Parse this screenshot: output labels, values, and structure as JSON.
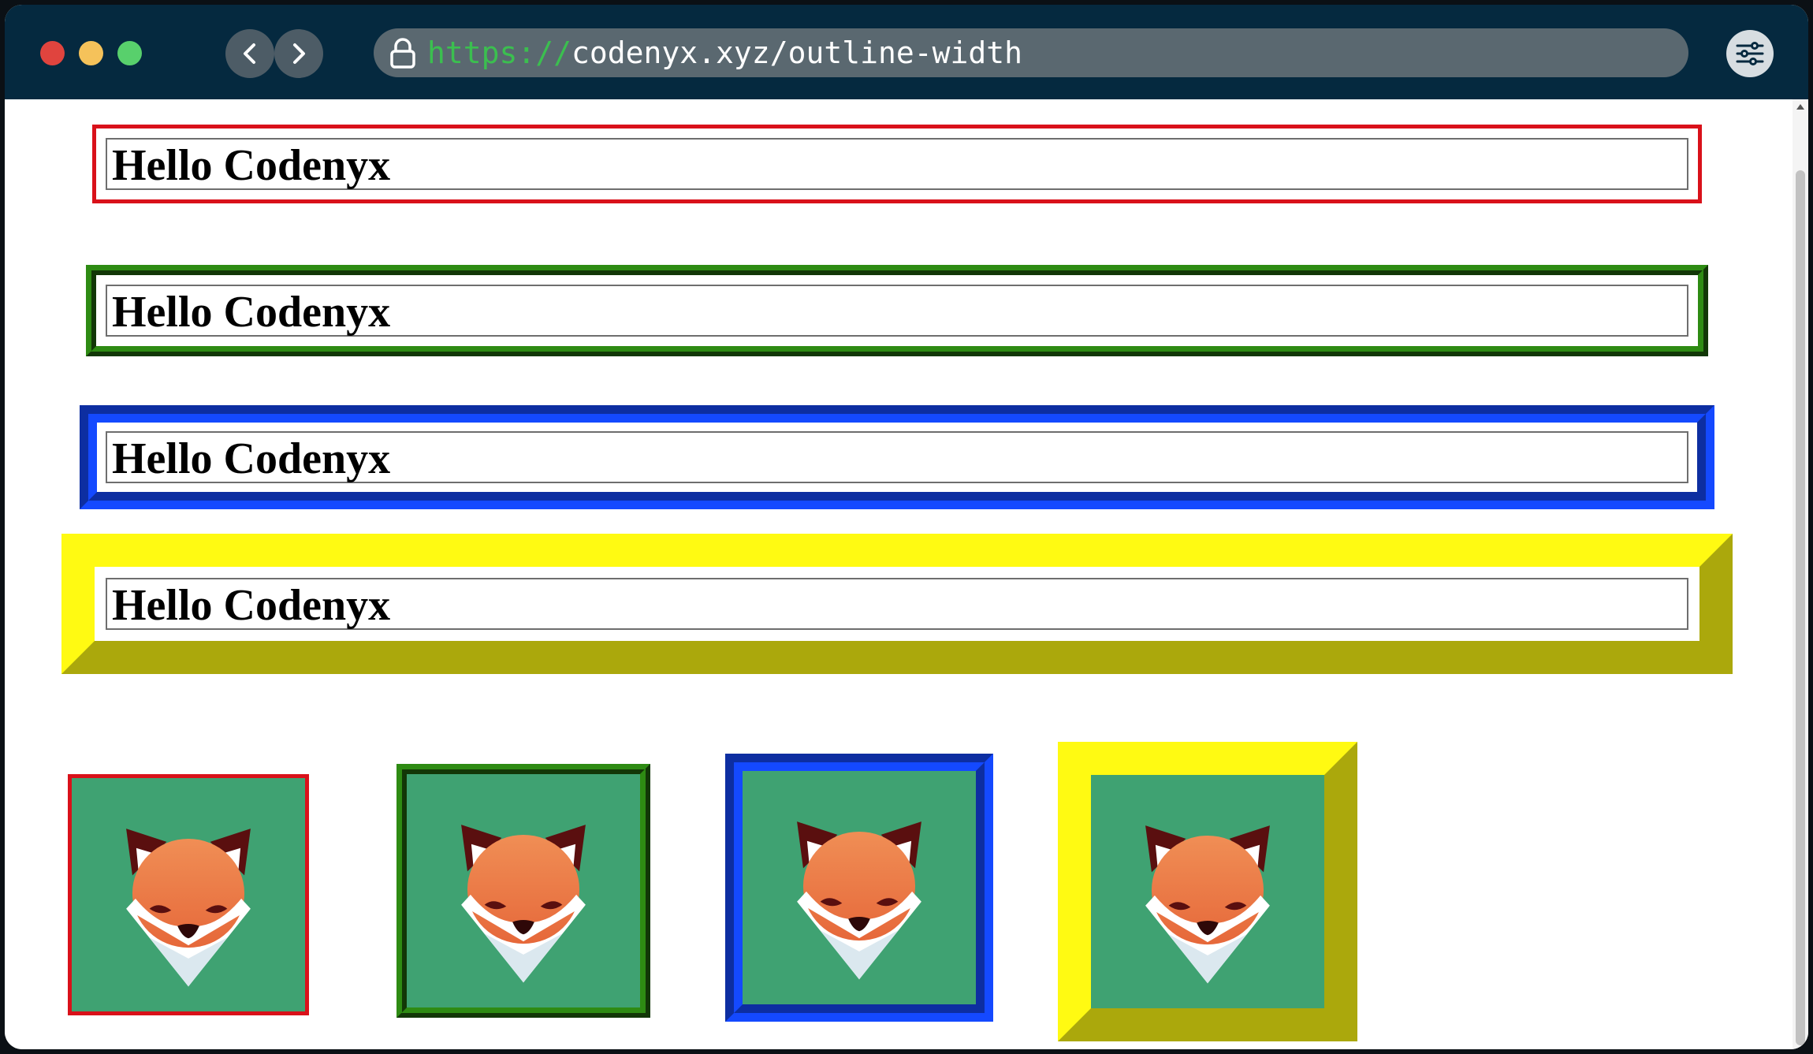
{
  "browser": {
    "url_scheme": "https://",
    "url_host": "codenyx.xyz/outline-width",
    "icons": {
      "back": "chevron-left-icon",
      "forward": "chevron-right-icon",
      "lock": "lock-icon",
      "settings": "sliders-icon"
    }
  },
  "page": {
    "boxes": [
      {
        "text": "Hello Codenyx",
        "outline_style": "solid",
        "outline_color": "#d9111a"
      },
      {
        "text": "Hello Codenyx",
        "outline_style": "ridge",
        "outline_color": "#2e8b13"
      },
      {
        "text": "Hello Codenyx",
        "outline_style": "groove",
        "outline_color": "#1446f5"
      },
      {
        "text": "Hello Codenyx",
        "outline_style": "outset",
        "outline_color": "#fffa12"
      }
    ],
    "images": [
      {
        "subject": "fox-logo",
        "outline_style": "solid",
        "outline_color": "#d9111a"
      },
      {
        "subject": "fox-logo",
        "outline_style": "ridge",
        "outline_color": "#2e8b13"
      },
      {
        "subject": "fox-logo",
        "outline_style": "groove",
        "outline_color": "#1446f5"
      },
      {
        "subject": "fox-logo",
        "outline_style": "outset",
        "outline_color": "#fffa12"
      }
    ]
  },
  "colors": {
    "titlebar": "#05293f",
    "urlbar": "#5a6870",
    "scheme_text": "#3bbf4f",
    "fox_background": "#3fa272",
    "fox_orange": "#ee7340",
    "fox_dark": "#5a0f0f"
  }
}
